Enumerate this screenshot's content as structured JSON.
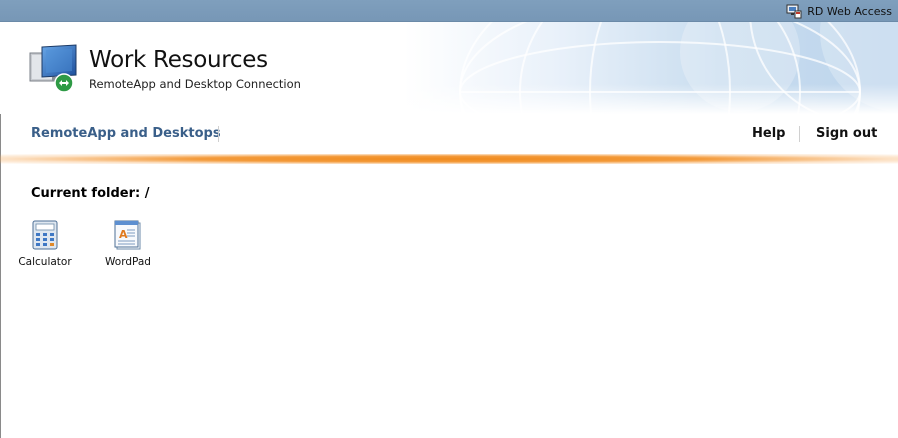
{
  "topbar": {
    "access_label": "RD Web Access",
    "icon": "rd-web-access-icon"
  },
  "header": {
    "title": "Work Resources",
    "subtitle": "RemoteApp and Desktop Connection",
    "logo_icon": "remote-desktop-logo-icon"
  },
  "nav": {
    "main_link": "RemoteApp and Desktops",
    "help": "Help",
    "sign_out": "Sign out"
  },
  "folder": {
    "label": "Current folder: /"
  },
  "apps": [
    {
      "label": "Calculator",
      "icon": "calculator-icon"
    },
    {
      "label": "WordPad",
      "icon": "wordpad-icon"
    }
  ],
  "colors": {
    "topbar": "#7797b6",
    "nav_link": "#3a5f89",
    "accent": "#f08a1c"
  }
}
